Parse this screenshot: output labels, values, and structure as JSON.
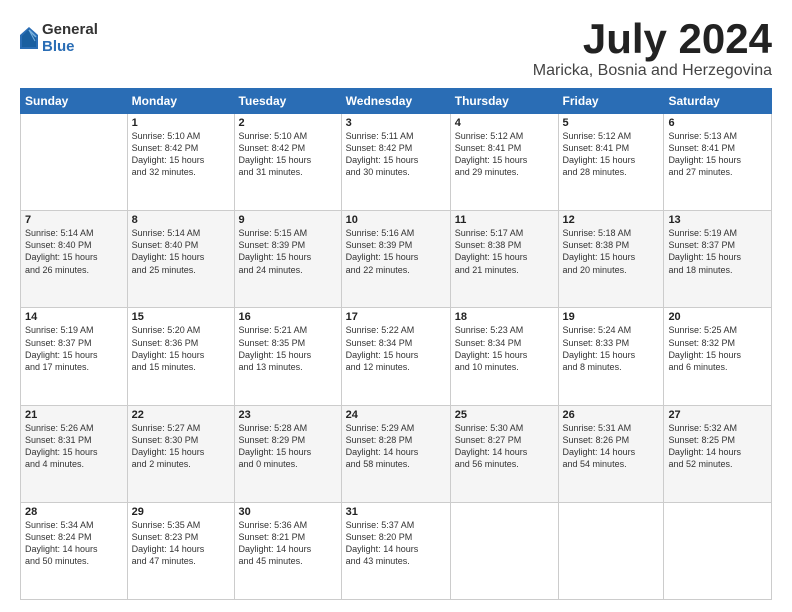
{
  "logo": {
    "general": "General",
    "blue": "Blue"
  },
  "header": {
    "month": "July 2024",
    "location": "Maricka, Bosnia and Herzegovina"
  },
  "weekdays": [
    "Sunday",
    "Monday",
    "Tuesday",
    "Wednesday",
    "Thursday",
    "Friday",
    "Saturday"
  ],
  "weeks": [
    [
      {
        "day": "",
        "info": ""
      },
      {
        "day": "1",
        "info": "Sunrise: 5:10 AM\nSunset: 8:42 PM\nDaylight: 15 hours\nand 32 minutes."
      },
      {
        "day": "2",
        "info": "Sunrise: 5:10 AM\nSunset: 8:42 PM\nDaylight: 15 hours\nand 31 minutes."
      },
      {
        "day": "3",
        "info": "Sunrise: 5:11 AM\nSunset: 8:42 PM\nDaylight: 15 hours\nand 30 minutes."
      },
      {
        "day": "4",
        "info": "Sunrise: 5:12 AM\nSunset: 8:41 PM\nDaylight: 15 hours\nand 29 minutes."
      },
      {
        "day": "5",
        "info": "Sunrise: 5:12 AM\nSunset: 8:41 PM\nDaylight: 15 hours\nand 28 minutes."
      },
      {
        "day": "6",
        "info": "Sunrise: 5:13 AM\nSunset: 8:41 PM\nDaylight: 15 hours\nand 27 minutes."
      }
    ],
    [
      {
        "day": "7",
        "info": "Sunrise: 5:14 AM\nSunset: 8:40 PM\nDaylight: 15 hours\nand 26 minutes."
      },
      {
        "day": "8",
        "info": "Sunrise: 5:14 AM\nSunset: 8:40 PM\nDaylight: 15 hours\nand 25 minutes."
      },
      {
        "day": "9",
        "info": "Sunrise: 5:15 AM\nSunset: 8:39 PM\nDaylight: 15 hours\nand 24 minutes."
      },
      {
        "day": "10",
        "info": "Sunrise: 5:16 AM\nSunset: 8:39 PM\nDaylight: 15 hours\nand 22 minutes."
      },
      {
        "day": "11",
        "info": "Sunrise: 5:17 AM\nSunset: 8:38 PM\nDaylight: 15 hours\nand 21 minutes."
      },
      {
        "day": "12",
        "info": "Sunrise: 5:18 AM\nSunset: 8:38 PM\nDaylight: 15 hours\nand 20 minutes."
      },
      {
        "day": "13",
        "info": "Sunrise: 5:19 AM\nSunset: 8:37 PM\nDaylight: 15 hours\nand 18 minutes."
      }
    ],
    [
      {
        "day": "14",
        "info": "Sunrise: 5:19 AM\nSunset: 8:37 PM\nDaylight: 15 hours\nand 17 minutes."
      },
      {
        "day": "15",
        "info": "Sunrise: 5:20 AM\nSunset: 8:36 PM\nDaylight: 15 hours\nand 15 minutes."
      },
      {
        "day": "16",
        "info": "Sunrise: 5:21 AM\nSunset: 8:35 PM\nDaylight: 15 hours\nand 13 minutes."
      },
      {
        "day": "17",
        "info": "Sunrise: 5:22 AM\nSunset: 8:34 PM\nDaylight: 15 hours\nand 12 minutes."
      },
      {
        "day": "18",
        "info": "Sunrise: 5:23 AM\nSunset: 8:34 PM\nDaylight: 15 hours\nand 10 minutes."
      },
      {
        "day": "19",
        "info": "Sunrise: 5:24 AM\nSunset: 8:33 PM\nDaylight: 15 hours\nand 8 minutes."
      },
      {
        "day": "20",
        "info": "Sunrise: 5:25 AM\nSunset: 8:32 PM\nDaylight: 15 hours\nand 6 minutes."
      }
    ],
    [
      {
        "day": "21",
        "info": "Sunrise: 5:26 AM\nSunset: 8:31 PM\nDaylight: 15 hours\nand 4 minutes."
      },
      {
        "day": "22",
        "info": "Sunrise: 5:27 AM\nSunset: 8:30 PM\nDaylight: 15 hours\nand 2 minutes."
      },
      {
        "day": "23",
        "info": "Sunrise: 5:28 AM\nSunset: 8:29 PM\nDaylight: 15 hours\nand 0 minutes."
      },
      {
        "day": "24",
        "info": "Sunrise: 5:29 AM\nSunset: 8:28 PM\nDaylight: 14 hours\nand 58 minutes."
      },
      {
        "day": "25",
        "info": "Sunrise: 5:30 AM\nSunset: 8:27 PM\nDaylight: 14 hours\nand 56 minutes."
      },
      {
        "day": "26",
        "info": "Sunrise: 5:31 AM\nSunset: 8:26 PM\nDaylight: 14 hours\nand 54 minutes."
      },
      {
        "day": "27",
        "info": "Sunrise: 5:32 AM\nSunset: 8:25 PM\nDaylight: 14 hours\nand 52 minutes."
      }
    ],
    [
      {
        "day": "28",
        "info": "Sunrise: 5:34 AM\nSunset: 8:24 PM\nDaylight: 14 hours\nand 50 minutes."
      },
      {
        "day": "29",
        "info": "Sunrise: 5:35 AM\nSunset: 8:23 PM\nDaylight: 14 hours\nand 47 minutes."
      },
      {
        "day": "30",
        "info": "Sunrise: 5:36 AM\nSunset: 8:21 PM\nDaylight: 14 hours\nand 45 minutes."
      },
      {
        "day": "31",
        "info": "Sunrise: 5:37 AM\nSunset: 8:20 PM\nDaylight: 14 hours\nand 43 minutes."
      },
      {
        "day": "",
        "info": ""
      },
      {
        "day": "",
        "info": ""
      },
      {
        "day": "",
        "info": ""
      }
    ]
  ]
}
